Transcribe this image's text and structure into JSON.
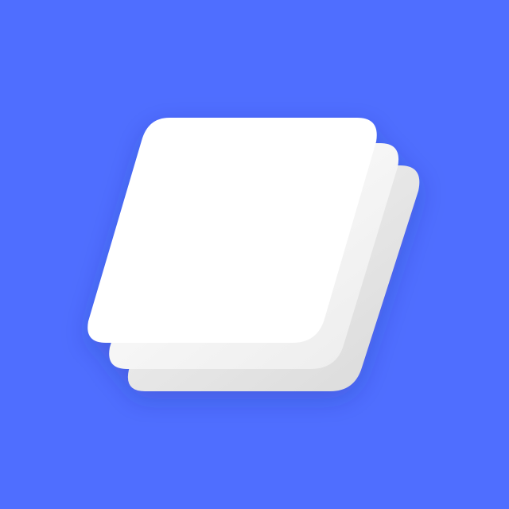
{
  "icon": {
    "name": "stacked-layers-icon",
    "colors": {
      "background": "#4F6EFF",
      "sheet_top": "#FFFFFF",
      "sheet_middle": "#F3F3F3",
      "sheet_bottom": "#ECECEC",
      "sheet_edge": "#DADADA"
    }
  }
}
